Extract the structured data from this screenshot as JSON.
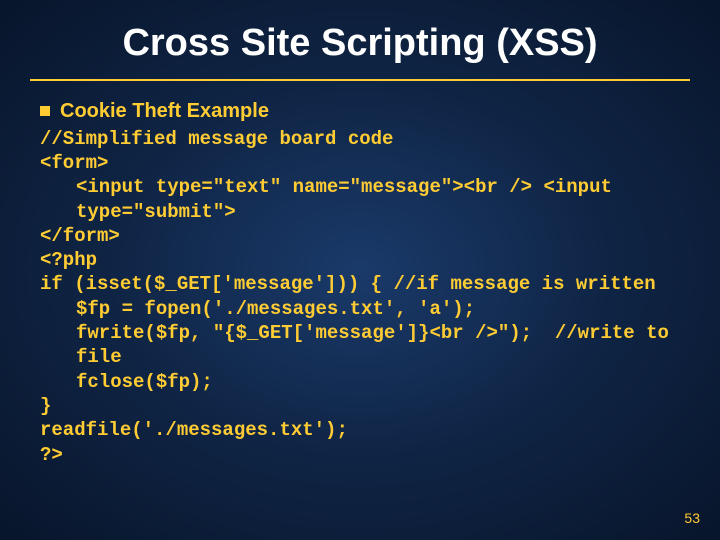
{
  "title": "Cross Site Scripting (XSS)",
  "bullet": "Cookie Theft Example",
  "code": {
    "l1": "//Simplified message board code",
    "l2": "<form>",
    "l3": "<input type=\"text\" name=\"message\"><br /> <input type=\"submit\">",
    "l4": "</form>",
    "l5": "<?php",
    "l6": "if (isset($_GET['message'])) { //if message is written",
    "l7": "$fp = fopen('./messages.txt', 'a');",
    "l8": "fwrite($fp, \"{$_GET['message']}<br />\");  //write to file",
    "l9": "fclose($fp);",
    "l10": "}",
    "l11": "readfile('./messages.txt');",
    "l12": "?>"
  },
  "page": "53"
}
